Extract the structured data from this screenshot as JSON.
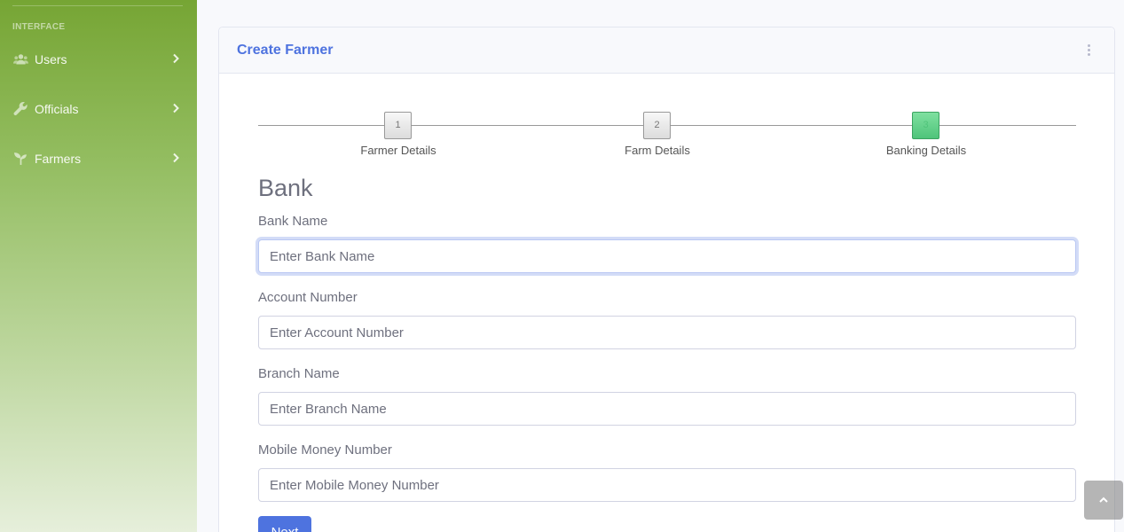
{
  "sidebar": {
    "heading": "INTERFACE",
    "items": [
      {
        "label": "Users",
        "icon": "users-icon"
      },
      {
        "label": "Officials",
        "icon": "wrench-icon"
      },
      {
        "label": "Farmers",
        "icon": "seedling-icon"
      }
    ]
  },
  "card": {
    "title": "Create Farmer",
    "menu_icon": "ellipsis-vertical-icon"
  },
  "wizard": {
    "steps": [
      {
        "number": "1",
        "label": "Farmer Details",
        "state": "done"
      },
      {
        "number": "2",
        "label": "Farm Details",
        "state": "done"
      },
      {
        "number": "3",
        "label": "Banking Details",
        "state": "active"
      }
    ],
    "active_color": "#4fc47a"
  },
  "form": {
    "section_title": "Bank",
    "fields": [
      {
        "label": "Bank Name",
        "placeholder": "Enter Bank Name",
        "value": ""
      },
      {
        "label": "Account Number",
        "placeholder": "Enter Account Number",
        "value": ""
      },
      {
        "label": "Branch Name",
        "placeholder": "Enter Branch Name",
        "value": ""
      },
      {
        "label": "Mobile Money Number",
        "placeholder": "Enter Mobile Money Number",
        "value": ""
      }
    ],
    "submit_label": "Next"
  },
  "scroll_top_icon": "chevron-up-icon",
  "colors": {
    "primary": "#4e73df",
    "sidebar_top": "#76a534",
    "sidebar_bottom": "#e6efdb",
    "text_muted": "#6e707e"
  }
}
